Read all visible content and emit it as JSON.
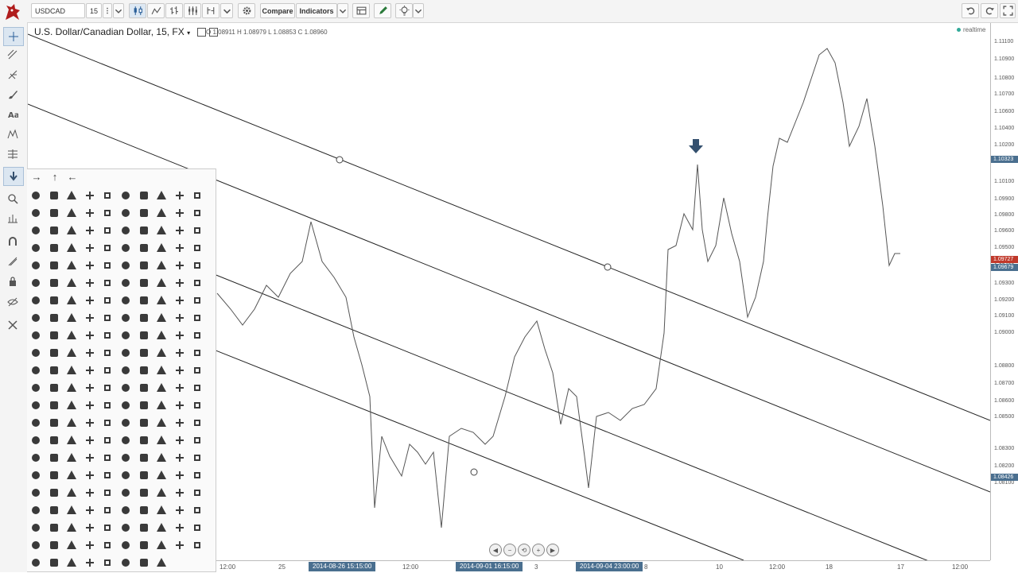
{
  "toolbar": {
    "symbol": "USDCAD",
    "interval": "15",
    "compare_label": "Compare",
    "indicators_label": "Indicators"
  },
  "legend": {
    "title": "U.S. Dollar/Canadian Dollar, 15, FX",
    "ohlc": "O 1.08911  H 1.08979  L 1.08853  C 1.08960",
    "realtime": "realtime"
  },
  "price_axis": {
    "labels": [
      "1.11100",
      "1.10900",
      "1.10800",
      "1.10700",
      "1.10600",
      "1.10400",
      "1.10200",
      "1.10100",
      "1.09900",
      "1.09800",
      "1.09600",
      "1.09500",
      "1.09400",
      "1.09300",
      "1.09200",
      "1.09100",
      "1.09000",
      "1.08800",
      "1.08700",
      "1.08600",
      "1.08500",
      "1.08300",
      "1.08200",
      "1.08100"
    ],
    "tags": [
      {
        "value": "1.10323",
        "color": "#4a6f8f"
      },
      {
        "value": "1.09727",
        "color": "#c0392b"
      },
      {
        "value": "1.09679",
        "color": "#4a6f8f"
      },
      {
        "value": "1.08426",
        "color": "#4a6f8f"
      }
    ]
  },
  "time_axis": {
    "labels": [
      "12:00",
      "25",
      "12:00",
      "3",
      "8",
      "10",
      "12:00",
      "18",
      "17",
      "12:00"
    ],
    "tags": [
      "2014-08-26 15:15:00",
      "2014-09-01 16:15:00",
      "2014-09-04 23:00:00"
    ]
  },
  "colors": {
    "marker_arrow": "#34506e",
    "price_tag_blue": "#4a6f8f",
    "price_tag_red": "#c0392b",
    "realtime_dot": "#33aa99"
  },
  "icon_palette": {
    "header_icons": [
      "arrow-right-icon",
      "arrow-up-icon",
      "arrow-left-icon"
    ],
    "grid_icons": [
      "arrow-left",
      "arrow-right",
      "arrow-up",
      "arrow-down",
      "flag",
      "flag-alt",
      "hand",
      "tag",
      "thumbs-up",
      "thumbs-down",
      "euro",
      "pound",
      "dollar",
      "rupee",
      "yen",
      "ruble",
      "won",
      "bitcoin",
      "glass",
      "music",
      "search",
      "envelope",
      "heart",
      "star",
      "star-empty",
      "user",
      "film",
      "grid",
      "list",
      "check",
      "close",
      "zoom-in",
      "zoom-out",
      "power",
      "signal",
      "gear",
      "trash",
      "home",
      "file",
      "clock",
      "road",
      "download",
      "upload",
      "inbox",
      "play-circle",
      "repeat",
      "refresh",
      "lock",
      "flag",
      "headphones",
      "volume-off",
      "volume-down",
      "volume-up",
      "qrcode",
      "barcode",
      "tag",
      "tags",
      "book",
      "bookmark",
      "print",
      "camera",
      "font",
      "bold",
      "italic",
      "text-height",
      "text-width",
      "align-left",
      "align-center",
      "align-right",
      "align-justify",
      "list-alt",
      "indent",
      "video",
      "picture",
      "pencil",
      "map-marker",
      "adjust",
      "tint",
      "edit",
      "share",
      "check-square",
      "move",
      "step-backward",
      "fast-backward",
      "backward",
      "play",
      "pause",
      "stop",
      "forward",
      "fast-forward",
      "step-forward",
      "eject",
      "chevron-left",
      "chevron-right",
      "plus-circle",
      "minus-circle",
      "times-circle",
      "check-circle",
      "question-circle",
      "info-circle",
      "crosshair",
      "ban",
      "arrow-circle",
      "share-alt",
      "expand",
      "compress",
      "plus",
      "minus",
      "asterisk",
      "exclamation-circle",
      "gift",
      "leaf",
      "fire",
      "eye",
      "eye-slash",
      "warning",
      "plane",
      "calendar",
      "random",
      "comment",
      "magnet",
      "chevron-up",
      "chevron-down",
      "retweet",
      "shopping-cart",
      "folder",
      "folder-open",
      "resize-v",
      "resize-h",
      "bar-chart",
      "twitter",
      "facebook",
      "camera-retro",
      "key",
      "gears",
      "comments",
      "thumbs-o-up",
      "thumbs-o-down",
      "star-half",
      "heart-o",
      "sign-out",
      "linkedin",
      "thumb-tack",
      "external-link",
      "sign-in",
      "trophy",
      "github",
      "upload",
      "lemon",
      "phone",
      "square-o",
      "bookmark-o",
      "phone-square",
      "twitter2",
      "facebook2",
      "github2",
      "unlock",
      "credit-card",
      "rss",
      "hdd",
      "bullhorn",
      "bell",
      "certificate",
      "hand-right",
      "hand-left",
      "hand-up",
      "hand-down",
      "arrow-circle-left",
      "arrow-circle-right",
      "arrow-circle-up",
      "arrow-circle-down",
      "globe",
      "wrench",
      "tasks",
      "filter",
      "briefcase",
      "fullscreen",
      "group",
      "link",
      "cloud",
      "flask",
      "cut",
      "copy",
      "paperclip",
      "save",
      "square",
      "bars",
      "list-ul",
      "list-ol",
      "strikethrough",
      "underline",
      "table",
      "magic",
      "truck",
      "pinterest",
      "pinterest-sq",
      "google-plus-sq",
      "google-plus",
      "money",
      "caret-down",
      "caret-up",
      "caret-left",
      "caret-right",
      "columns",
      "sort",
      "sort-down",
      "sort-up",
      "envelope-alt",
      "linkedin2",
      "undo",
      "gavel",
      "dashboard",
      "comment-o",
      "comments-o",
      "bolt",
      "sitemap",
      "umbrella",
      "paste"
    ]
  }
}
